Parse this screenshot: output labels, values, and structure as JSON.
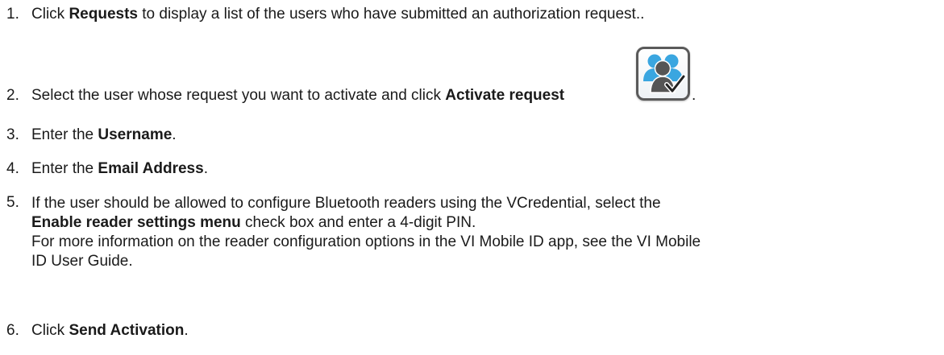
{
  "steps": [
    {
      "num": "1.",
      "pre": "Click ",
      "bold": "Requests",
      "post": " to display a list of the users who have submitted an authorization request.."
    },
    {
      "num": "2.",
      "pre": "Select the user whose request you want to activate and click ",
      "bold": "Activate request",
      "post": "."
    },
    {
      "num": "3.",
      "pre": "Enter the ",
      "bold": "Username",
      "post": "."
    },
    {
      "num": "4.",
      "pre": "Enter the ",
      "bold": "Email Address",
      "post": "."
    },
    {
      "num": "5.",
      "line1": "If the user should be allowed to configure Bluetooth readers using the VCredential, select the",
      "bold": "Enable reader settings menu",
      "line2_post": " check box and enter a 4-digit PIN.",
      "line3": "For more information on the reader configuration options in the VI Mobile ID app, see the VI Mobile",
      "line4": "ID User Guide."
    },
    {
      "num": "6.",
      "pre": "Click ",
      "bold": "Send Activation",
      "post": "."
    }
  ],
  "icons": {
    "activate_request": "users-checkmark-icon"
  },
  "colors": {
    "icon_blue": "#3aa6e0",
    "icon_gray": "#555555",
    "text": "#1a1a1a"
  }
}
